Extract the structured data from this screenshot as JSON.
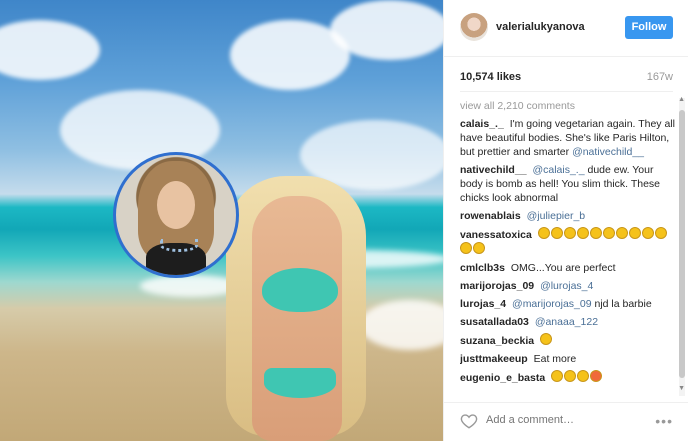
{
  "photo": {
    "alt_icons": [
      "inset-portrait",
      "main-photo"
    ]
  },
  "header": {
    "username": "valerialukyanova",
    "follow_label": "Follow"
  },
  "stats": {
    "likes": "10,574 likes",
    "time": "167w"
  },
  "comments": {
    "view_all": "view all 2,210 comments",
    "items": [
      {
        "user": "calais_._",
        "text": "I'm going vegetarian again. They all have beautiful bodies. She's like Paris Hilton, but prettier and smarter",
        "mention": "@nativechild__"
      },
      {
        "user": "nativechild__",
        "mention_first": "@calais_._",
        "text": "dude ew. Your body is bomb as hell! You slim thick. These chicks look abnormal"
      },
      {
        "user": "rowenablais",
        "mention": "@juliepier_b"
      },
      {
        "user": "vanessatoxica",
        "emoji_count": 12
      },
      {
        "user": "cmlclb3s",
        "text": "OMG...You are perfect"
      },
      {
        "user": "marijorojas_09",
        "mention": "@lurojas_4"
      },
      {
        "user": "lurojas_4",
        "mention_first": "@marijorojas_09",
        "text": "njd la barbie"
      },
      {
        "user": "susatallada03",
        "mention": "@anaaa_122"
      },
      {
        "user": "suzana_beckia",
        "emoji_count": 1
      },
      {
        "user": "justtmakeeup",
        "text": "Eat more"
      },
      {
        "user": "eugenio_e_basta",
        "emoji_count": 4
      }
    ]
  },
  "footer": {
    "add_comment_placeholder": "Add a comment…",
    "more_label": "•••"
  },
  "colors": {
    "follow_blue": "#3897f0",
    "mention_blue": "#4a6f96"
  }
}
